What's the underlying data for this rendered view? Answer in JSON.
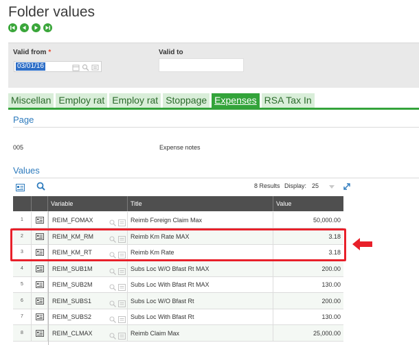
{
  "page": {
    "title": "Folder values"
  },
  "nav": [
    "first-icon",
    "previous-icon",
    "next-icon",
    "last-icon"
  ],
  "criteria": {
    "valid_from_label": "Valid from",
    "required_mark": "*",
    "valid_from_value": "03/01/16",
    "valid_to_label": "Valid to",
    "valid_to_value": ""
  },
  "tabs": [
    {
      "label": "Miscellan",
      "active": false
    },
    {
      "label": "Employ rat",
      "active": false
    },
    {
      "label": "Employ rat",
      "active": false
    },
    {
      "label": "Stoppage",
      "active": false
    },
    {
      "label": "Expenses",
      "active": true
    },
    {
      "label": "RSA Tax In",
      "active": false
    }
  ],
  "page_section": {
    "heading": "Page",
    "code": "005",
    "description": "Expense notes"
  },
  "values_section": {
    "heading": "Values",
    "results": "8 Results",
    "display_label": "Display:",
    "display_value": "25",
    "columns": {
      "variable": "Variable",
      "title": "Title",
      "value": "Value"
    },
    "rows": [
      {
        "num": "1",
        "variable": "REIM_FOMAX",
        "title": "Reimb Foreign Claim Max",
        "value": "50,000.00"
      },
      {
        "num": "2",
        "variable": "REIM_KM_RM",
        "title": "Reimb Km Rate MAX",
        "value": "3.18"
      },
      {
        "num": "3",
        "variable": "REIM_KM_RT",
        "title": "Reimb Km Rate",
        "value": "3.18"
      },
      {
        "num": "4",
        "variable": "REIM_SUB1M",
        "title": "Subs Loc W/O Bfast Rt MAX",
        "value": "200.00"
      },
      {
        "num": "5",
        "variable": "REIM_SUB2M",
        "title": "Subs Loc With Bfast Rt MAX",
        "value": "130.00"
      },
      {
        "num": "6",
        "variable": "REIM_SUBS1",
        "title": "Subs Loc W/O Bfast Rt",
        "value": "200.00"
      },
      {
        "num": "7",
        "variable": "REIM_SUBS2",
        "title": "Subs Loc With Bfast Rt",
        "value": "130.00"
      },
      {
        "num": "8",
        "variable": "REIM_CLMAX",
        "title": "Reimb Claim Max",
        "value": "25,000.00"
      }
    ]
  },
  "colors": {
    "accent_green": "#33a33a",
    "link_blue": "#2e7bbd",
    "highlight_red": "#e8202a",
    "header_dark": "#4f4f4f"
  }
}
